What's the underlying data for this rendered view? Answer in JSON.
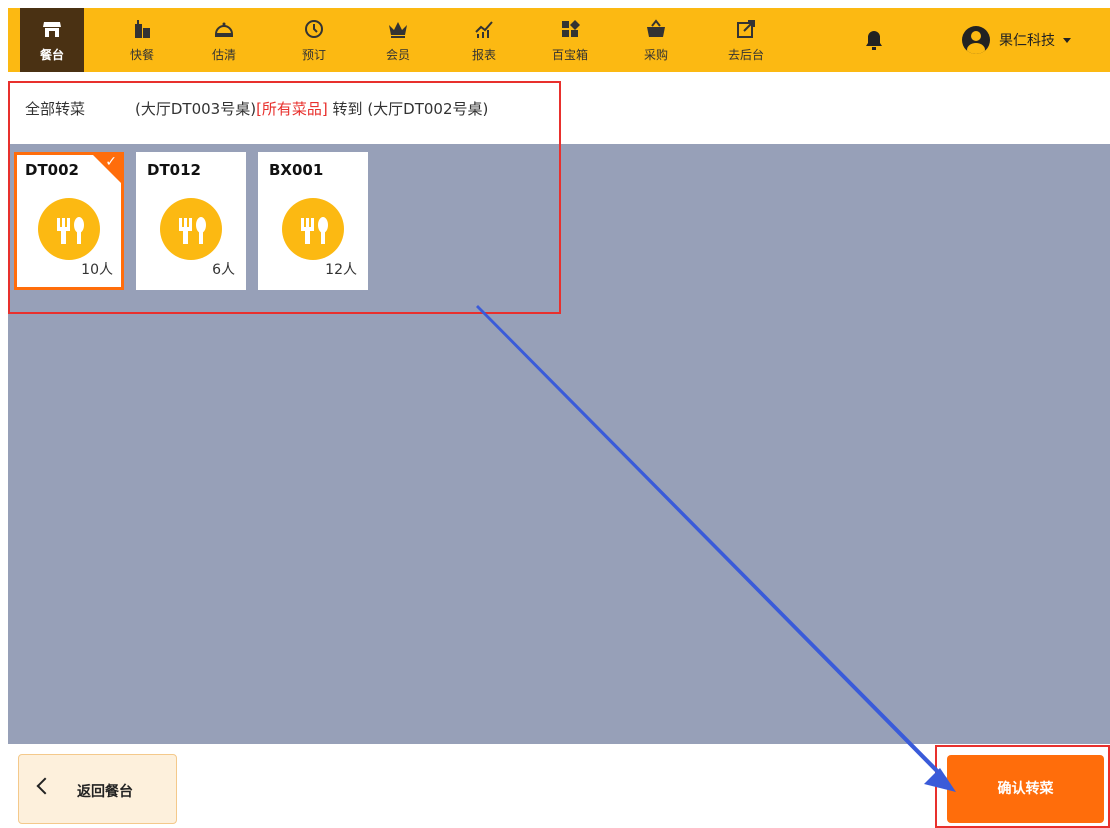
{
  "nav": {
    "items": [
      {
        "label": "餐台",
        "icon": "store-icon",
        "active": true
      },
      {
        "label": "快餐",
        "icon": "fast-food-icon",
        "active": false
      },
      {
        "label": "估清",
        "icon": "cloche-icon",
        "active": false
      },
      {
        "label": "预订",
        "icon": "clock-icon",
        "active": false
      },
      {
        "label": "会员",
        "icon": "crown-icon",
        "active": false
      },
      {
        "label": "报表",
        "icon": "chart-icon",
        "active": false
      },
      {
        "label": "百宝箱",
        "icon": "grid-icon",
        "active": false
      },
      {
        "label": "采购",
        "icon": "basket-icon",
        "active": false
      },
      {
        "label": "去后台",
        "icon": "external-link-icon",
        "active": false
      }
    ],
    "bell_icon": "bell-icon",
    "user_name": "果仁科技"
  },
  "transfer": {
    "label": "全部转菜",
    "from_text": "(大厅DT003号桌)",
    "scope_text": "[所有菜品]",
    "to_text": " 转到 (大厅DT002号桌)"
  },
  "tables": [
    {
      "code": "DT002",
      "count": "10人",
      "selected": true
    },
    {
      "code": "DT012",
      "count": "6人",
      "selected": false
    },
    {
      "code": "BX001",
      "count": "12人",
      "selected": false
    }
  ],
  "footer": {
    "back_label": "返回餐台",
    "confirm_label": "确认转菜"
  },
  "colors": {
    "nav_bg": "#fcb912",
    "nav_active_bg": "#4a3113",
    "accent": "#ff6d0b",
    "highlight": "#e8302d",
    "table_area_bg": "#97a0b8",
    "arrow": "#3a5bd9"
  }
}
